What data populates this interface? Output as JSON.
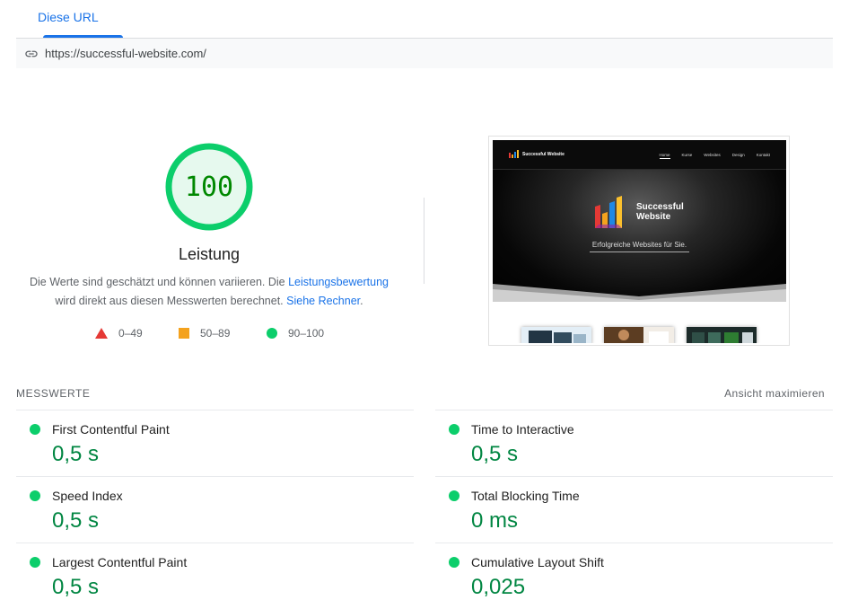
{
  "tabs": {
    "active_label": "Diese URL"
  },
  "url_bar": {
    "icon": "link-icon",
    "url": "https://successful-website.com/"
  },
  "score": {
    "value": "100",
    "title": "Leistung",
    "desc_part1": "Die Werte sind geschätzt und können variieren. Die ",
    "desc_link1": "Leistungsbewertung",
    "desc_part2": "wird direkt aus diesen Messwerten berechnet. ",
    "desc_link2": "Siehe Rechner",
    "desc_end": ".",
    "ring_color": "#0cce6b",
    "fill_color": "#e6f9ee",
    "text_color": "#008800"
  },
  "legend": [
    {
      "shape": "triangle",
      "color": "#e53935",
      "label": "0–49"
    },
    {
      "shape": "square",
      "color": "#f4a21d",
      "label": "50–89"
    },
    {
      "shape": "circle",
      "color": "#0cce6b",
      "label": "90–100"
    }
  ],
  "screenshot": {
    "site_logo_text": "Successful Website",
    "menu": [
      "Home",
      "Kurse",
      "Websites",
      "Design",
      "Kontakt"
    ],
    "brand_line1": "Successful",
    "brand_line2": "Website",
    "slogan": "Erfolgreiche Websites für Sie."
  },
  "metrics_header": {
    "label": "MESSWERTE",
    "action": "Ansicht maximieren"
  },
  "metrics": {
    "left": [
      {
        "name": "First Contentful Paint",
        "value": "0,5 s",
        "status": "good"
      },
      {
        "name": "Speed Index",
        "value": "0,5 s",
        "status": "good"
      },
      {
        "name": "Largest Contentful Paint",
        "value": "0,5 s",
        "status": "good"
      }
    ],
    "right": [
      {
        "name": "Time to Interactive",
        "value": "0,5 s",
        "status": "good"
      },
      {
        "name": "Total Blocking Time",
        "value": "0 ms",
        "status": "good"
      },
      {
        "name": "Cumulative Layout Shift",
        "value": "0,025",
        "status": "good"
      }
    ]
  },
  "colors": {
    "accent": "#1a73e8",
    "good": "#0cce6b",
    "good_text": "#018642"
  }
}
